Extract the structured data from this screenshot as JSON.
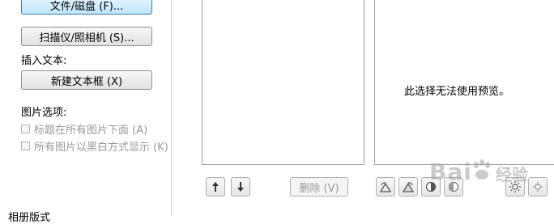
{
  "left_panel": {
    "file_disk_button": "文件/磁盘 (F)...",
    "scanner_camera_button": "扫描仪/照相机 (S)...",
    "insert_text_label": "插入文本:",
    "new_text_box_button": "新建文本框 (X)",
    "picture_options_label": "图片选项:",
    "caption_below_checkbox": "标题在所有图片下面 (A)",
    "black_white_checkbox": "所有图片以黑白方式显示 (K)",
    "album_layout_label": "相册版式"
  },
  "list_controls": {
    "move_up_icon": "up-arrow-icon",
    "move_down_icon": "down-arrow-icon",
    "delete_button": "删除 (V)"
  },
  "preview": {
    "message": "此选择无法使用预览。"
  },
  "image_tools": {
    "icons": [
      "rotate-left-icon",
      "rotate-right-icon",
      "contrast-increase-icon",
      "contrast-decrease-icon",
      "brightness-increase-icon",
      "brightness-decrease-icon"
    ]
  },
  "watermark": {
    "text": "Bai",
    "text2": "经验"
  }
}
